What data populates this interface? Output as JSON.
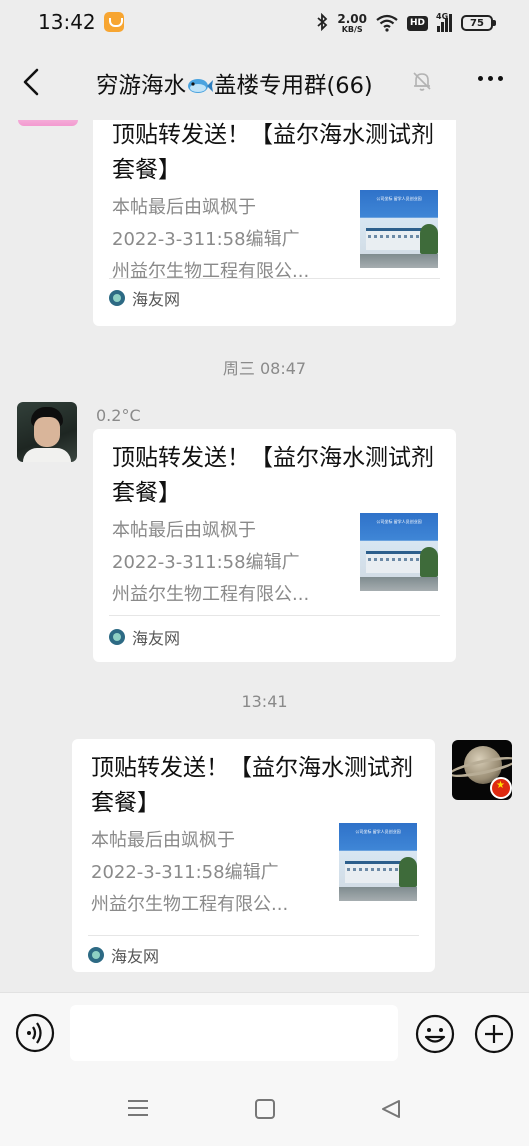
{
  "status_bar": {
    "time": "13:42",
    "net_speed_value": "2.00",
    "net_speed_unit": "KB/S",
    "hd_label": "HD",
    "signal_label": "4G",
    "battery": "75"
  },
  "header": {
    "title_part1": "穷游海水",
    "title_part2": "盖楼专用群(66)"
  },
  "messages": [
    {
      "title": "顶贴转发送！【益尔海水测试剂套餐】",
      "desc": [
        "本帖最后由飒枫于",
        "2022-3-311:58编辑广",
        "州益尔生物工程有限公..."
      ],
      "source": "海友网"
    },
    {
      "timestamp": "周三 08:47",
      "nickname": "0.2°C",
      "title": "顶贴转发送！【益尔海水测试剂套餐】",
      "desc": [
        "本帖最后由飒枫于",
        "2022-3-311:58编辑广",
        "州益尔生物工程有限公..."
      ],
      "source": "海友网"
    },
    {
      "timestamp": "13:41",
      "title": "顶贴转发送！【益尔海水测试剂套餐】",
      "desc": [
        "本帖最后由飒枫于",
        "2022-3-311:58编辑广",
        "州益尔生物工程有限公..."
      ],
      "source": "海友网"
    }
  ],
  "thumb_banner": "公司坐标 留学人员创业园",
  "input": {
    "value": "",
    "placeholder": ""
  },
  "icons": {
    "back": "back-icon",
    "fish": "fish-icon",
    "mute": "mute-bell-icon",
    "more": "more-icon",
    "voice": "voice-icon",
    "emoji": "emoji-icon",
    "plus": "plus-icon",
    "nav_menu": "menu-icon",
    "nav_home": "home-icon",
    "nav_back": "back-triangle-icon"
  }
}
